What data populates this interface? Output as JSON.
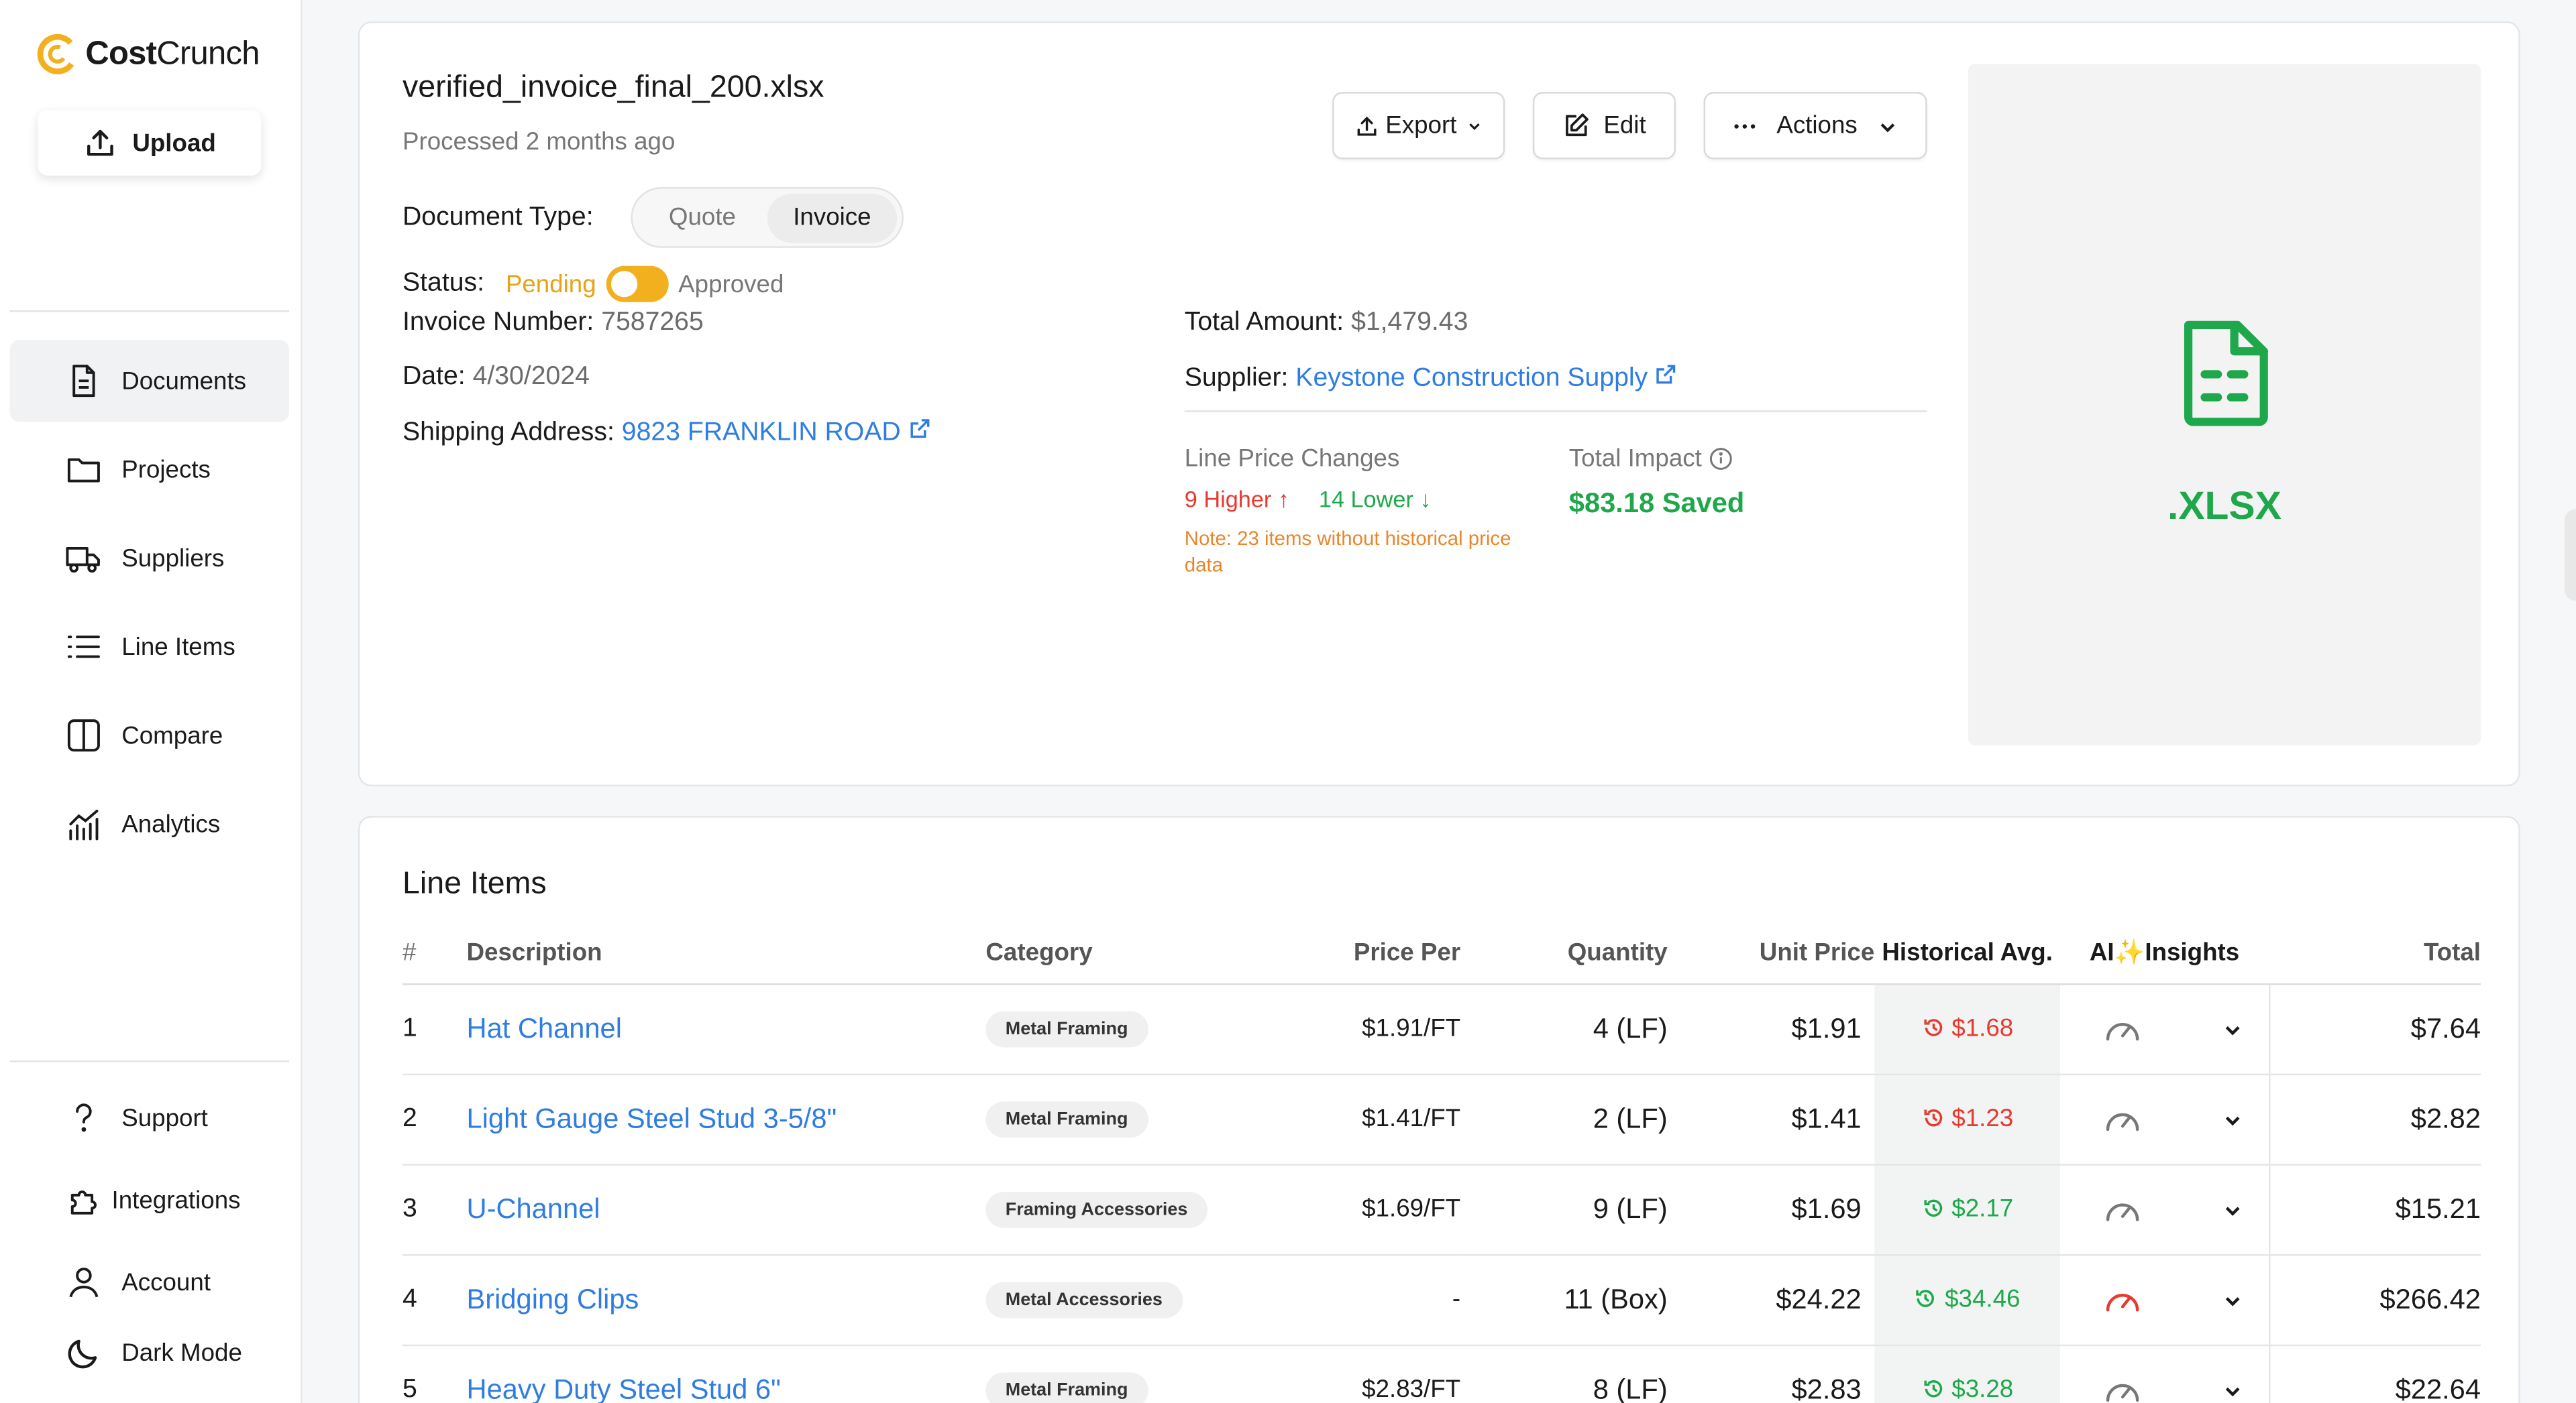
{
  "brand": {
    "name_bold": "Cost",
    "name_rest": "Crunch",
    "accent": "#f2b01e"
  },
  "sidebar": {
    "upload_label": "Upload",
    "items": [
      {
        "label": "Documents",
        "icon": "document-icon"
      },
      {
        "label": "Projects",
        "icon": "folder-icon"
      },
      {
        "label": "Suppliers",
        "icon": "truck-icon"
      },
      {
        "label": "Line Items",
        "icon": "list-icon"
      },
      {
        "label": "Compare",
        "icon": "columns-icon"
      },
      {
        "label": "Analytics",
        "icon": "chart-icon"
      }
    ],
    "bottom": [
      {
        "label": "Support",
        "icon": "question-icon"
      },
      {
        "label": "Integrations",
        "icon": "puzzle-icon"
      },
      {
        "label": "Account",
        "icon": "user-icon"
      },
      {
        "label": "Dark Mode",
        "icon": "moon-icon"
      }
    ]
  },
  "document": {
    "file_name": "verified_invoice_final_200.xlsx",
    "processed": "Processed 2 months ago",
    "export_label": "Export",
    "edit_label": "Edit",
    "actions_label": "Actions",
    "doc_type_label": "Document Type:",
    "doc_type_options": [
      "Quote",
      "Invoice"
    ],
    "status_label": "Status:",
    "status_pending": "Pending",
    "status_approved": "Approved",
    "invoice_number_label": "Invoice Number:",
    "invoice_number": "7587265",
    "date_label": "Date:",
    "date": "4/30/2024",
    "shipping_label": "Shipping Address:",
    "shipping_address": "9823 FRANKLIN ROAD",
    "total_label": "Total Amount:",
    "total": "$1,479.43",
    "supplier_label": "Supplier:",
    "supplier": "Keystone Construction Supply",
    "price_changes_label": "Line Price Changes",
    "higher": "9 Higher",
    "lower": "14 Lower",
    "note": "Note: 23 items without historical price data",
    "impact_label": "Total Impact",
    "impact_value": "$83.18 Saved",
    "preview_ext": ".XLSX"
  },
  "line_items": {
    "title": "Line Items",
    "columns": [
      "#",
      "Description",
      "Category",
      "Price Per",
      "Quantity",
      "Unit Price",
      "Historical Avg.",
      "AI",
      "Insights",
      "Total"
    ],
    "rows": [
      {
        "n": "1",
        "desc": "Hat Channel",
        "cat": "Metal Framing",
        "price_per": "$1.91/FT",
        "qty": "4 (LF)",
        "unit": "$1.91",
        "hist": "$1.68",
        "hist_color": "red",
        "gauge": "normal",
        "total": "$7.64"
      },
      {
        "n": "2",
        "desc": "Light Gauge Steel Stud 3-5/8\"",
        "cat": "Metal Framing",
        "price_per": "$1.41/FT",
        "qty": "2 (LF)",
        "unit": "$1.41",
        "hist": "$1.23",
        "hist_color": "red",
        "gauge": "normal",
        "total": "$2.82"
      },
      {
        "n": "3",
        "desc": "U-Channel",
        "cat": "Framing Accessories",
        "price_per": "$1.69/FT",
        "qty": "9 (LF)",
        "unit": "$1.69",
        "hist": "$2.17",
        "hist_color": "green",
        "gauge": "normal",
        "total": "$15.21"
      },
      {
        "n": "4",
        "desc": "Bridging Clips",
        "cat": "Metal Accessories",
        "price_per": "-",
        "qty": "11 (Box)",
        "unit": "$24.22",
        "hist": "$34.46",
        "hist_color": "green",
        "gauge": "alert",
        "total": "$266.42"
      },
      {
        "n": "5",
        "desc": "Heavy Duty Steel Stud 6\"",
        "cat": "Metal Framing",
        "price_per": "$2.83/FT",
        "qty": "8 (LF)",
        "unit": "$2.83",
        "hist": "$3.28",
        "hist_color": "green",
        "gauge": "normal",
        "total": "$22.64"
      }
    ]
  }
}
